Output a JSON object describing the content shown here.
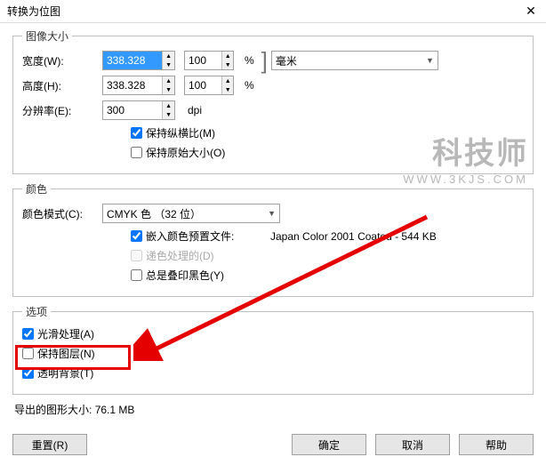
{
  "title": "转换为位图",
  "close_icon": "✕",
  "watermark": {
    "big": "科技师",
    "small": "WWW.3KJS.COM"
  },
  "groups": {
    "image_size": {
      "legend": "图像大小",
      "width_label": "宽度(W):",
      "width_value": "338.328",
      "width_percent": "100",
      "height_label": "高度(H):",
      "height_value": "338.328",
      "height_percent": "100",
      "percent_sign": "%",
      "bracket": "]",
      "unit_label": "毫米",
      "resolution_label": "分辨率(E):",
      "resolution_value": "300",
      "resolution_unit": "dpi",
      "keep_aspect": "保持纵横比(M)",
      "keep_original": "保持原始大小(O)"
    },
    "color": {
      "legend": "颜色",
      "mode_label": "颜色模式(C):",
      "mode_value": "CMYK 色 （32 位）",
      "embed_profile": "嵌入颜色预置文件:",
      "profile_info": "Japan Color 2001 Coated - 544 KB",
      "dither": "递色处理的(D)",
      "always_overprint": "总是叠印黑色(Y)"
    },
    "options": {
      "legend": "选项",
      "smooth": "光滑处理(A)",
      "keep_layers": "保持图层(N)",
      "transparent": "透明背景(T)"
    }
  },
  "export_size_label": "导出的图形大小:",
  "export_size_value": "76.1 MB",
  "buttons": {
    "reset": "重置(R)",
    "ok": "确定",
    "cancel": "取消",
    "help": "帮助"
  }
}
